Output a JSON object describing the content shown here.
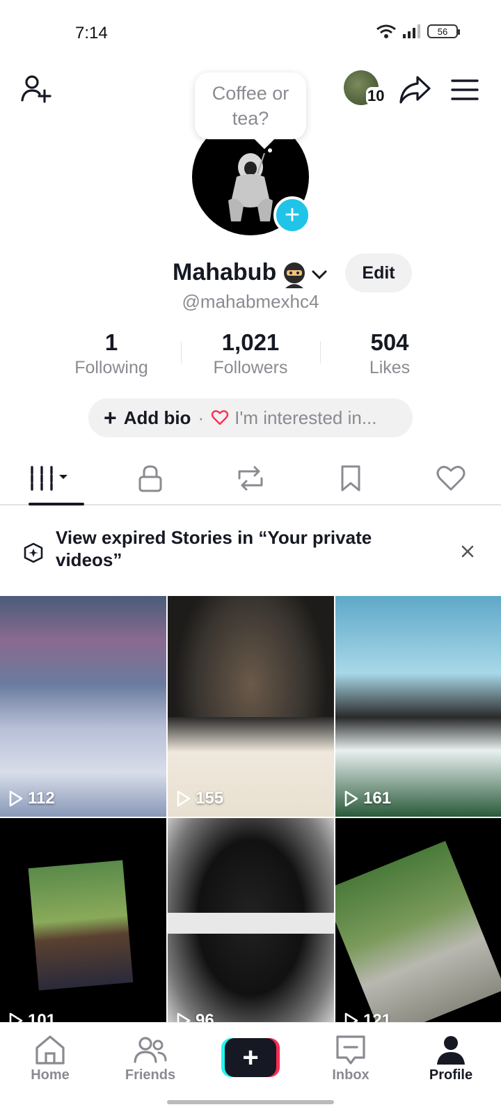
{
  "status_bar": {
    "time": "7:14",
    "battery": "56"
  },
  "header": {
    "friends_count": "10",
    "icons": [
      "add-friend-icon",
      "share-icon",
      "menu-icon"
    ]
  },
  "profile": {
    "note_bubble": "Coffee or tea?",
    "display_name": "Mahabub",
    "handle": "@mahabmexhc4",
    "edit_label": "Edit"
  },
  "stats": [
    {
      "value": "1",
      "label": "Following"
    },
    {
      "value": "1,021",
      "label": "Followers"
    },
    {
      "value": "504",
      "label": "Likes"
    }
  ],
  "bio": {
    "add_label": "Add bio",
    "separator": "·",
    "interest_label": "I'm interested in..."
  },
  "tabs": [
    "videos-tab",
    "private-tab",
    "reposts-tab",
    "favorites-tab",
    "liked-tab"
  ],
  "notice": {
    "text": "View expired Stories in “Your private videos”"
  },
  "videos": [
    {
      "views": "112"
    },
    {
      "views": "155"
    },
    {
      "views": "161"
    },
    {
      "views": "101"
    },
    {
      "views": "96"
    },
    {
      "views": "121"
    }
  ],
  "bottom_nav": {
    "home": "Home",
    "friends": "Friends",
    "inbox": "Inbox",
    "profile": "Profile"
  },
  "colors": {
    "accent_cyan": "#20c4e8",
    "tiktok_red": "#fe2c55",
    "tiktok_cyan": "#25f4ee",
    "text": "#161823",
    "muted": "#8a8b91"
  }
}
